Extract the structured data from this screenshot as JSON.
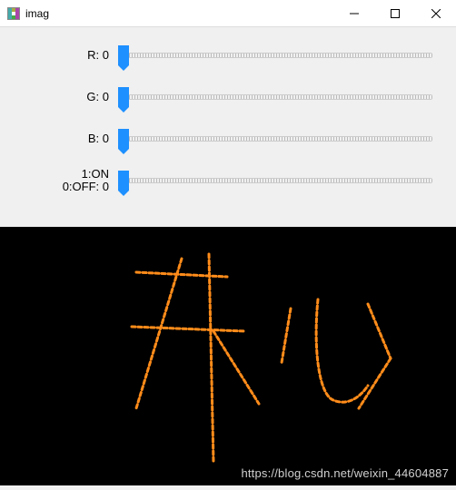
{
  "window": {
    "title": "imag",
    "minimize_icon": "minimize-icon",
    "maximize_icon": "maximize-icon",
    "close_icon": "close-icon"
  },
  "trackbars": [
    {
      "label": "R: ",
      "value": 0,
      "min": 0,
      "max": 255,
      "display": "R: 0"
    },
    {
      "label": "G: ",
      "value": 0,
      "min": 0,
      "max": 255,
      "display": "G: 0"
    },
    {
      "label": "B: ",
      "value": 0,
      "min": 0,
      "max": 255,
      "display": "B: 0"
    },
    {
      "label": "1:ON\n0:OFF: ",
      "value": 0,
      "min": 0,
      "max": 1,
      "display": "1:ON\n0:OFF: 0"
    }
  ],
  "canvas": {
    "background": "#000000",
    "stroke_color": "#ff8c1a",
    "content_description": "handwritten-chinese-characters-kaixin"
  },
  "watermark": "https://blog.csdn.net/weixin_44604887"
}
